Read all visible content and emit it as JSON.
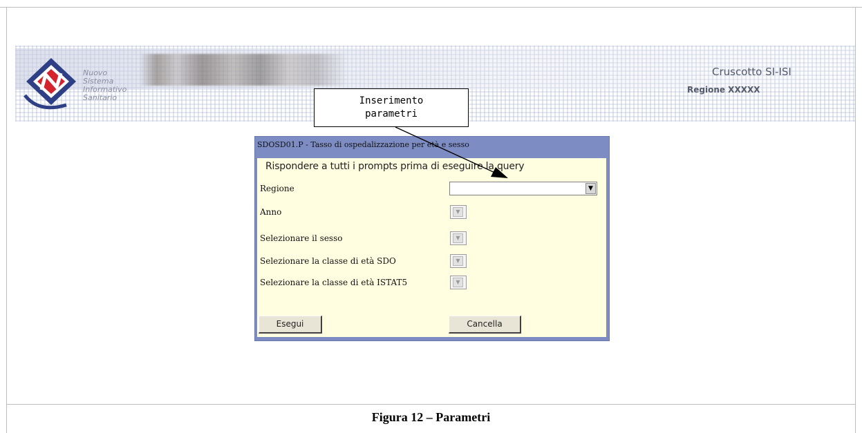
{
  "header": {
    "logo_lines": [
      "Nuovo",
      "Sistema",
      "Informativo",
      "Sanitario"
    ],
    "app_title": "Cruscotto SI-ISI",
    "region": "Regione XXXXX"
  },
  "callout": {
    "line1": "Inserimento",
    "line2": "parametri"
  },
  "form": {
    "title": "SDOSD01.P - Tasso di ospedalizzazione per età e sesso",
    "instructions": "Rispondere a tutti i prompts prima di eseguire la query",
    "fields": [
      {
        "label": "Regione",
        "value": ""
      },
      {
        "label": "Anno",
        "value": ""
      },
      {
        "label": "Selezionare il sesso",
        "value": ""
      },
      {
        "label": "Selezionare la classe di età SDO",
        "value": ""
      },
      {
        "label": "Selezionare la classe di età ISTAT5",
        "value": ""
      }
    ],
    "execute_label": "Esegui",
    "cancel_label": "Cancella"
  },
  "caption": "Figura 12 – Parametri",
  "colors": {
    "panel_border": "#7d8cc2",
    "panel_bg": "#fffee0"
  },
  "icons": {
    "dropdown": "chevron-down-icon",
    "logo": "nsis-logo"
  }
}
